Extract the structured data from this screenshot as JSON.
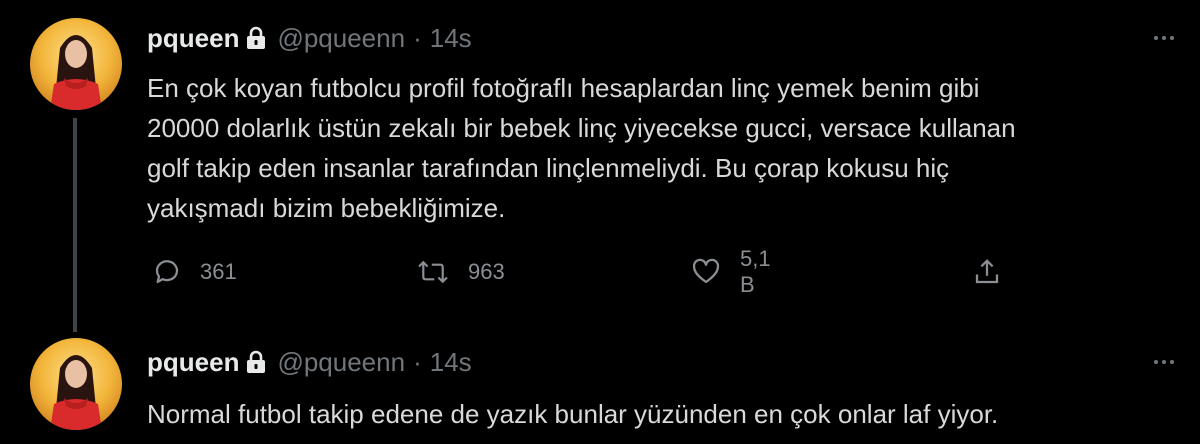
{
  "tweets": [
    {
      "author": {
        "name": "pqueen",
        "handle": "@pqueenn",
        "protected_icon": "lock-icon"
      },
      "separator": "·",
      "time": "14s",
      "lines": [
        "En çok koyan futbolcu profil fotoğraflı hesaplardan linç yemek benim gibi",
        "20000 dolarlık üstün zekalı bir bebek linç yiyecekse gucci, versace kullanan",
        "golf takip eden insanlar tarafından linçlenmeliydi. Bu çorap kokusu hiç",
        "yakışmadı bizim bebekliğimize."
      ],
      "actions": {
        "replies": "361",
        "retweets": "963",
        "likes": "5,1 B"
      }
    },
    {
      "author": {
        "name": "pqueen",
        "handle": "@pqueenn",
        "protected_icon": "lock-icon"
      },
      "separator": "·",
      "time": "14s",
      "lines": [
        "Normal futbol takip edene de yazık bunlar yüzünden en çok onlar laf yiyor."
      ]
    }
  ],
  "colors": {
    "background": "#000000",
    "text": "#d9d9d9",
    "secondary": "#71767b",
    "thread_line": "#3f4448"
  },
  "icons": [
    "more-icon",
    "reply-icon",
    "retweet-icon",
    "like-icon",
    "share-icon"
  ]
}
